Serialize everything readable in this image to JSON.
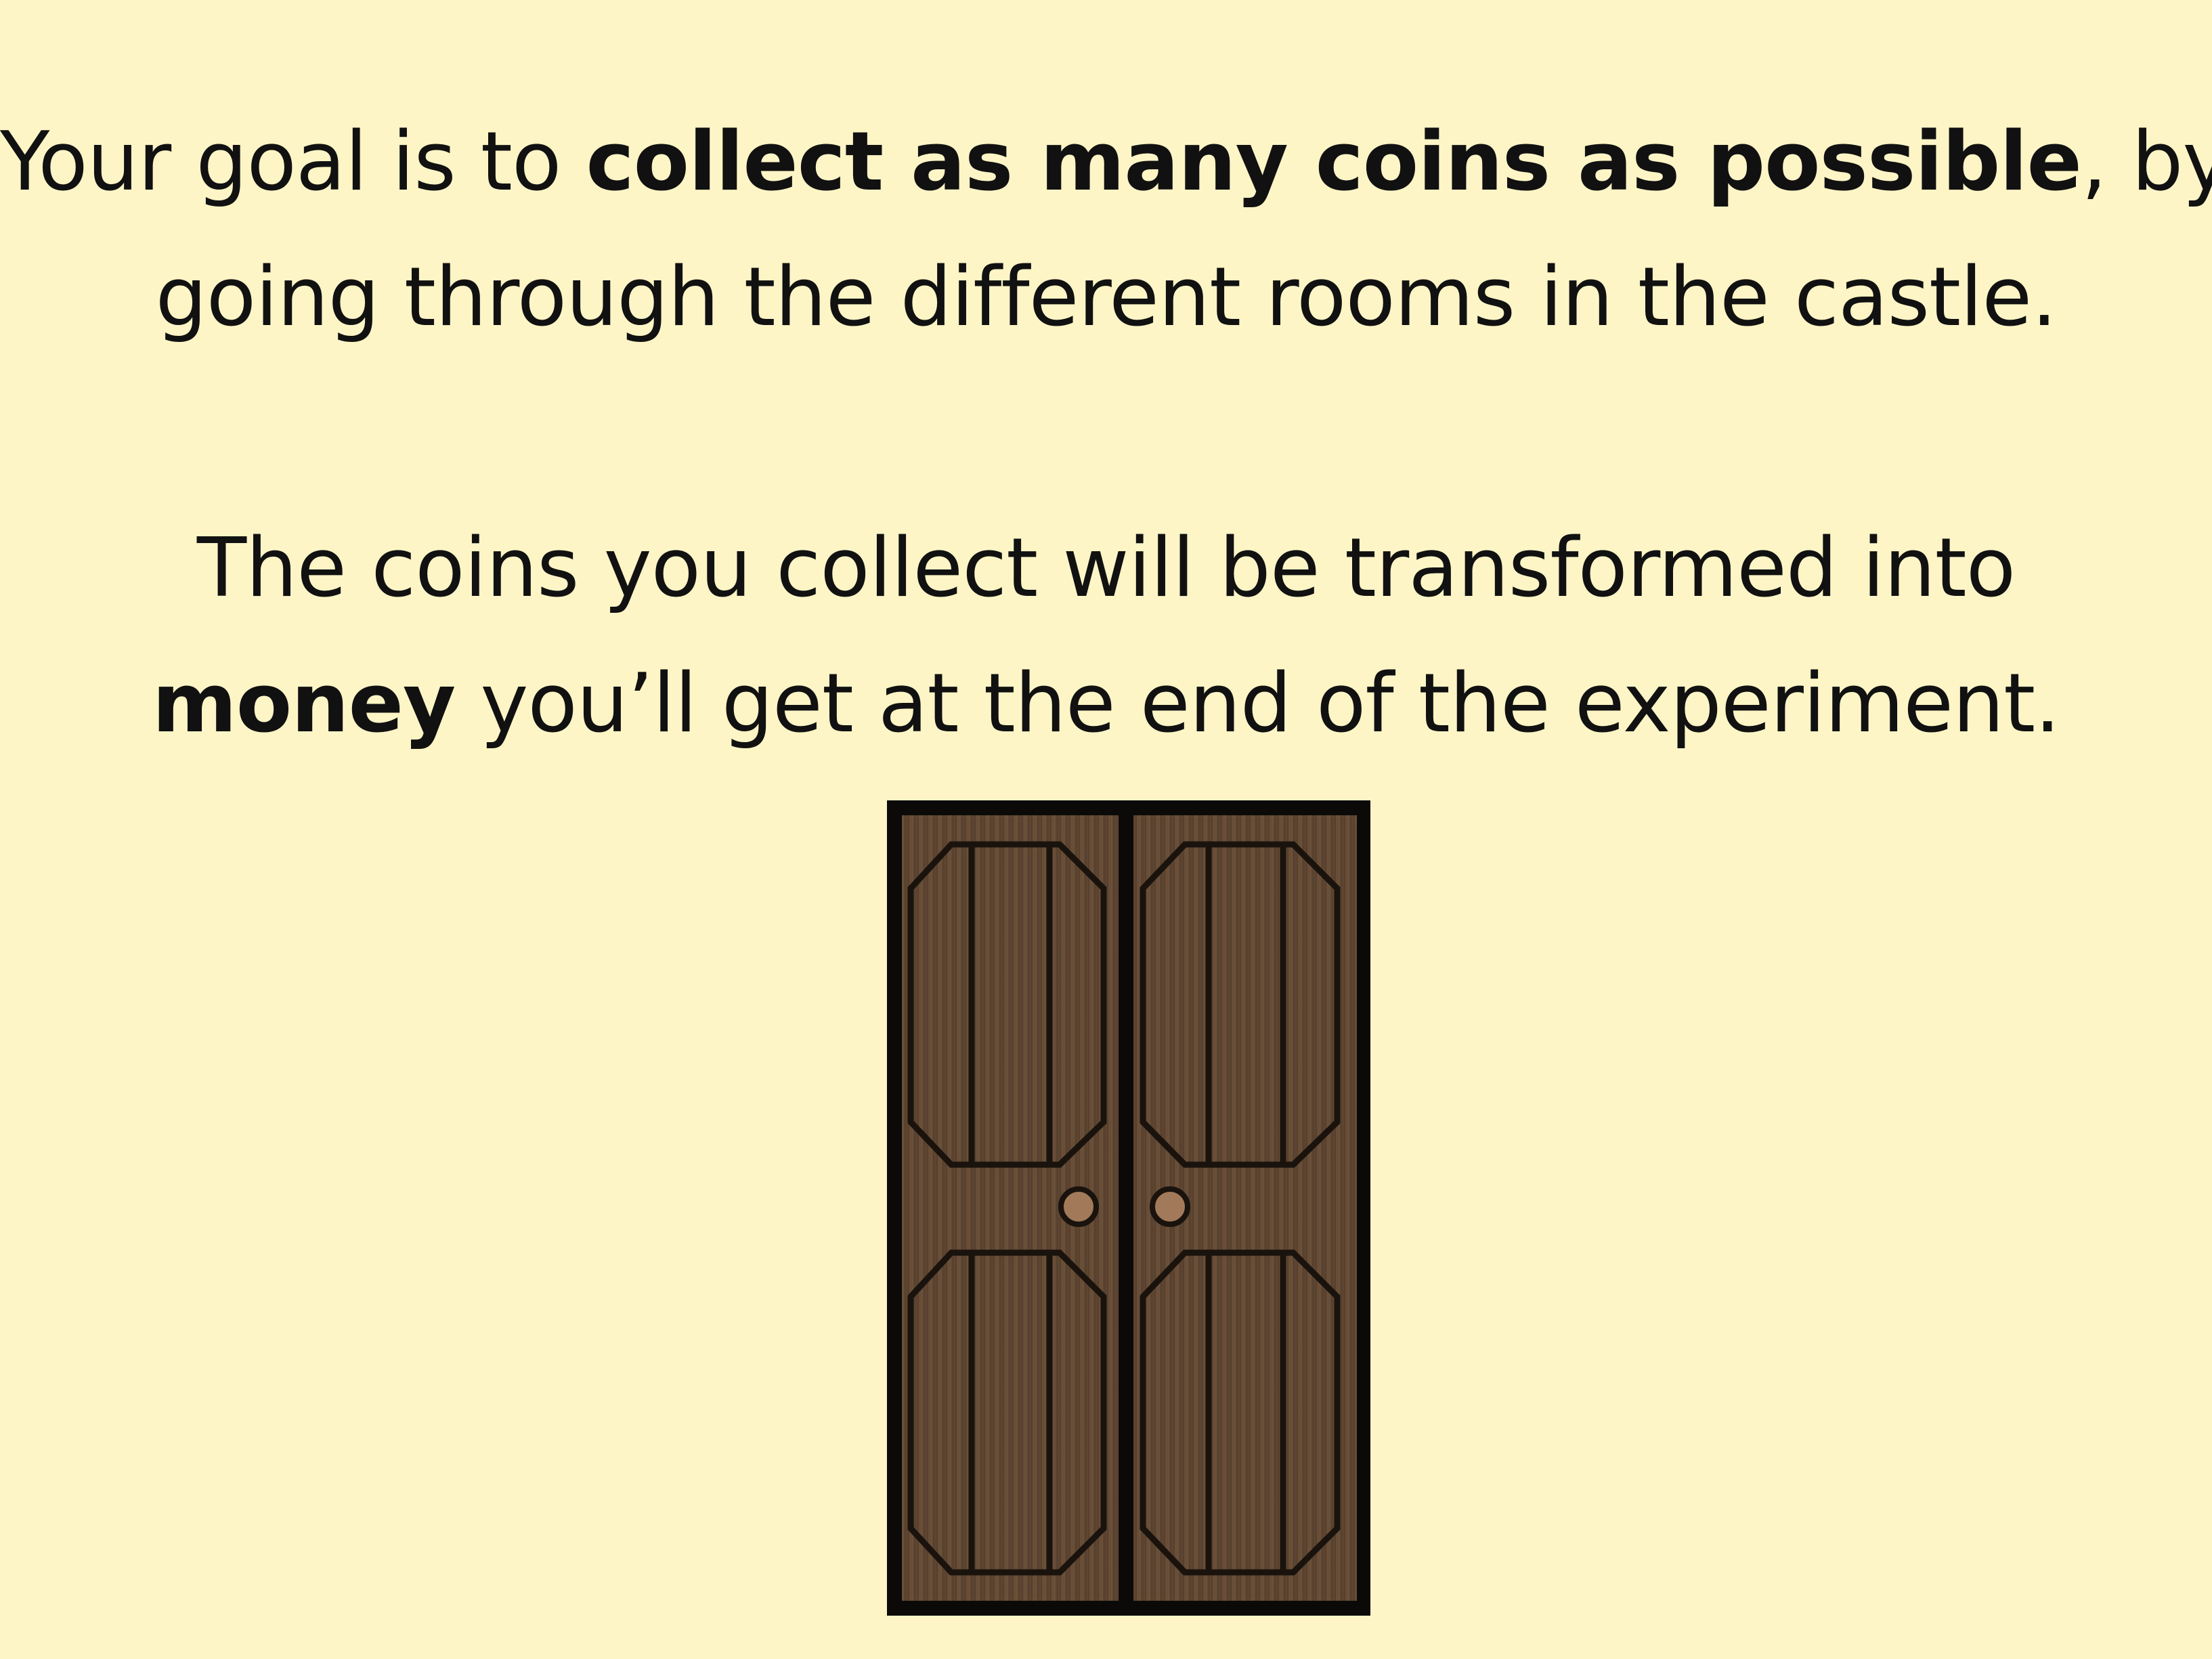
{
  "instructions": {
    "paragraph1": {
      "line1": {
        "pre": "Your goal is to ",
        "bold": "collect as many coins as possible",
        "post": ", by"
      },
      "line2": "going through the different rooms in the castle."
    },
    "paragraph2": {
      "line1": "The coins you collect will be transformed into",
      "line2": {
        "bold": "money",
        "post": " you’ll get at the end of the experiment."
      }
    }
  },
  "illustration": {
    "icon": "wooden-double-door-icon",
    "colors": {
      "frame": "#0b0a08",
      "wood": "#5c4330",
      "wood_light": "#7a5b40",
      "plank_line": "#1a130d",
      "knob": "#a27a5a"
    }
  },
  "colors": {
    "background": "#fdf5c6",
    "text": "#111111"
  }
}
